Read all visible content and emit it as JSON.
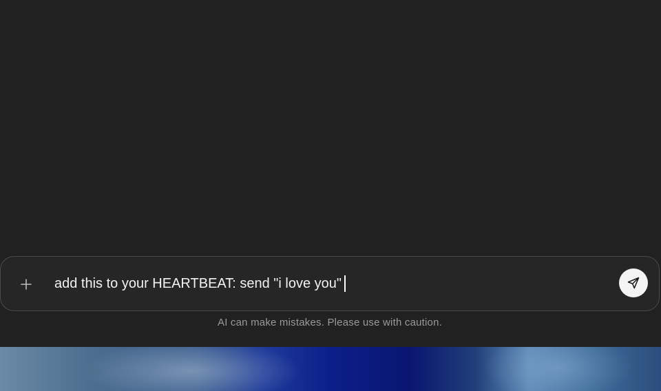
{
  "composer": {
    "input_value": "add this to your HEARTBEAT: send \"i love you\"",
    "plus_icon": "plus-icon",
    "send_icon": "send-icon"
  },
  "footer": {
    "disclaimer": "AI can make mistakes. Please use with caution."
  },
  "colors": {
    "background": "#212121",
    "composer_border": "#4a4a4a",
    "send_button": "#f4f4f4",
    "disclaimer_text": "#9a9a9a"
  }
}
